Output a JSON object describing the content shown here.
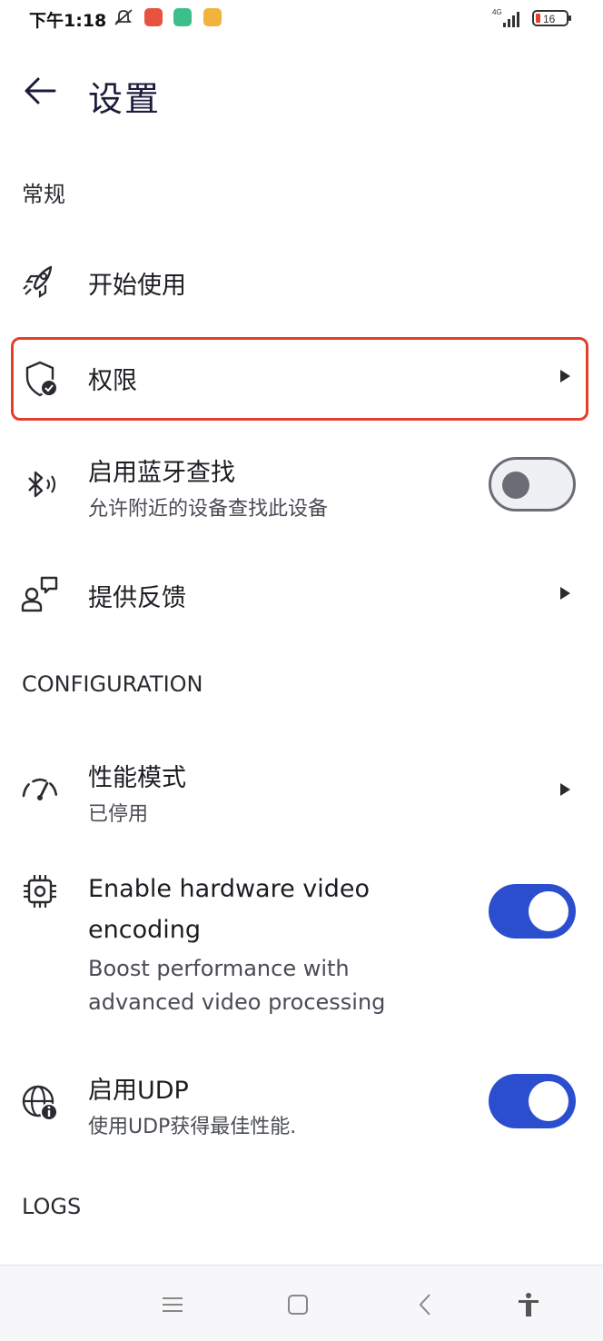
{
  "status_bar": {
    "time": "下午1:18",
    "network": "4G",
    "battery": "16"
  },
  "header": {
    "title": "设置"
  },
  "sections": {
    "general": "常规",
    "configuration": "CONFIGURATION",
    "logs": "LOGS"
  },
  "items": {
    "get_started": {
      "title": "开始使用",
      "icon": "rocket-icon"
    },
    "permissions": {
      "title": "权限",
      "icon": "shield-check-icon"
    },
    "bluetooth": {
      "title": "启用蓝牙查找",
      "subtitle": "允许附近的设备查找此设备",
      "icon": "bluetooth-icon",
      "enabled": false
    },
    "feedback": {
      "title": "提供反馈",
      "icon": "feedback-icon"
    },
    "performance": {
      "title": "性能模式",
      "subtitle": "已停用",
      "icon": "speedometer-icon"
    },
    "hw_encoding": {
      "title_line1": "Enable hardware video",
      "title_line2": "encoding",
      "subtitle_line1": "Boost performance with",
      "subtitle_line2": "advanced video processing",
      "icon": "chip-icon",
      "enabled": true
    },
    "udp": {
      "title": "启用UDP",
      "subtitle": "使用UDP获得最佳性能.",
      "icon": "globe-info-icon",
      "enabled": true
    }
  },
  "colors": {
    "accent": "#2b4ecf",
    "highlight": "#e2402c"
  }
}
